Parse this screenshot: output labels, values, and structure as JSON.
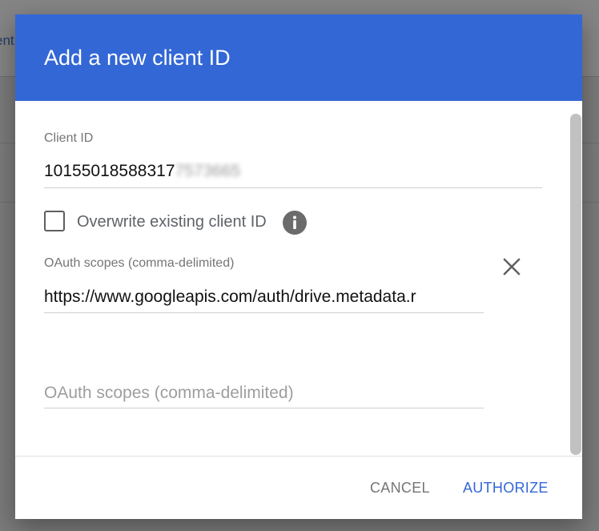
{
  "background": {
    "fragment_text": "ent"
  },
  "dialog": {
    "title": "Add a new client ID",
    "client_id": {
      "label": "Client ID",
      "value_visible": "10155018588317",
      "value_redacted": "7573665"
    },
    "overwrite": {
      "label": "Overwrite existing client ID",
      "checked": false,
      "info_icon": "info-icon"
    },
    "scopes": {
      "label": "OAuth scopes (comma-delimited)",
      "value": "https://www.googleapis.com/auth/drive.metadata.r",
      "remove_icon": "close-icon",
      "new_placeholder": "OAuth scopes (comma-delimited)"
    },
    "buttons": {
      "cancel": "CANCEL",
      "authorize": "AUTHORIZE"
    }
  },
  "colors": {
    "header": "#3367d6",
    "primary_button": "#3367d6",
    "secondary_button": "#757575"
  }
}
